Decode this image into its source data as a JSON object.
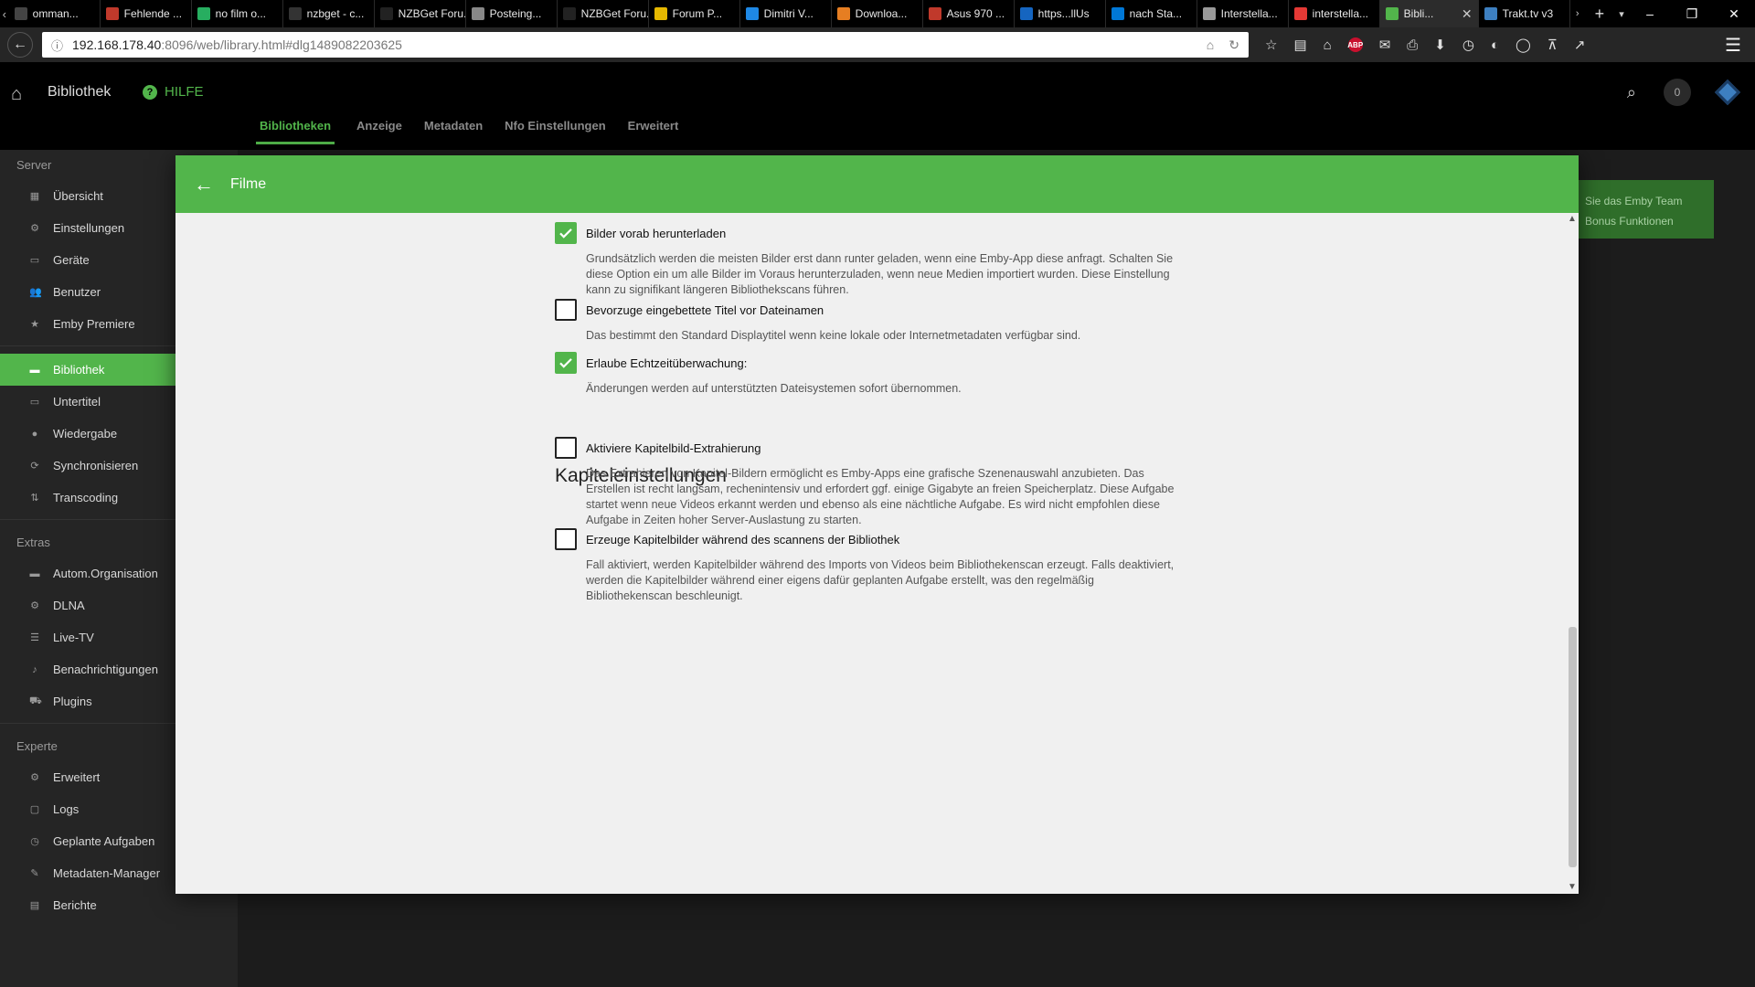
{
  "browser": {
    "tabs": [
      {
        "label": "omman...",
        "color": "#444"
      },
      {
        "label": "Fehlende ...",
        "color": "#c0392b"
      },
      {
        "label": "no film o...",
        "color": "#27ae60"
      },
      {
        "label": "nzbget - c...",
        "color": "#333"
      },
      {
        "label": "NZBGet Foru...",
        "color": "#222"
      },
      {
        "label": "Posteing...",
        "color": "#888"
      },
      {
        "label": "NZBGet Foru...",
        "color": "#222"
      },
      {
        "label": "Forum P...",
        "color": "#e6b800"
      },
      {
        "label": "Dimitri V...",
        "color": "#1e88e5"
      },
      {
        "label": "Downloa...",
        "color": "#e67e22"
      },
      {
        "label": "Asus 970 ...",
        "color": "#c0392b"
      },
      {
        "label": "https...llUs",
        "color": "#1565c0"
      },
      {
        "label": "nach Sta...",
        "color": "#0078d7"
      },
      {
        "label": "Interstella...",
        "color": "#999"
      },
      {
        "label": "interstella...",
        "color": "#e53935"
      },
      {
        "label": "Bibli...",
        "color": "#52b54b",
        "active": true
      },
      {
        "label": "Trakt.tv v3",
        "color": "#3d7fc0"
      }
    ],
    "url_host": "192.168.178.40",
    "url_rest": ":8096/web/library.html#dlg1489082203625"
  },
  "header": {
    "title": "Bibliothek",
    "help_label": "HILFE",
    "notification_count": "0",
    "tabs": [
      "Bibliotheken",
      "Anzeige",
      "Metadaten",
      "Nfo Einstellungen",
      "Erweitert"
    ]
  },
  "sidebar": {
    "sections": [
      {
        "heading": "Server",
        "items": [
          {
            "label": "Übersicht",
            "icon": "dashboard-icon"
          },
          {
            "label": "Einstellungen",
            "icon": "gear-icon"
          },
          {
            "label": "Geräte",
            "icon": "device-icon"
          },
          {
            "label": "Benutzer",
            "icon": "users-icon"
          },
          {
            "label": "Emby Premiere",
            "icon": "star-icon"
          }
        ]
      },
      {
        "heading": "",
        "items": [
          {
            "label": "Bibliothek",
            "icon": "folder-icon",
            "active": true
          },
          {
            "label": "Untertitel",
            "icon": "subtitles-icon"
          },
          {
            "label": "Wiedergabe",
            "icon": "play-icon"
          },
          {
            "label": "Synchronisieren",
            "icon": "sync-icon"
          },
          {
            "label": "Transcoding",
            "icon": "transcode-icon"
          }
        ]
      },
      {
        "heading": "Extras",
        "items": [
          {
            "label": "Autom.Organisation",
            "icon": "folder-icon"
          },
          {
            "label": "DLNA",
            "icon": "gear-icon"
          },
          {
            "label": "Live-TV",
            "icon": "tv-icon"
          },
          {
            "label": "Benachrichtigungen",
            "icon": "bell-icon"
          },
          {
            "label": "Plugins",
            "icon": "cart-icon"
          }
        ]
      },
      {
        "heading": "Experte",
        "items": [
          {
            "label": "Erweitert",
            "icon": "gear-icon"
          },
          {
            "label": "Logs",
            "icon": "folder-open-icon"
          },
          {
            "label": "Geplante Aufgaben",
            "icon": "clock-icon"
          },
          {
            "label": "Metadaten-Manager",
            "icon": "pencil-icon"
          },
          {
            "label": "Berichte",
            "icon": "report-icon"
          }
        ]
      }
    ]
  },
  "promo": {
    "line1": "Sie das Emby Team",
    "line2": "Bonus Funktionen"
  },
  "dialog": {
    "title": "Filme",
    "section_title": "Kapiteleinstellungen",
    "options": [
      {
        "label": "Bilder vorab herunterladen",
        "checked": true,
        "description": "Grundsätzlich werden die meisten Bilder erst dann runter geladen, wenn eine Emby-App diese anfragt. Schalten Sie diese Option ein um alle Bilder im Voraus herunterzuladen, wenn neue Medien importiert wurden. Diese Einstellung kann zu signifikant längeren Bibliothekscans führen."
      },
      {
        "label": "Bevorzuge eingebettete Titel vor Dateinamen",
        "checked": false,
        "description": "Das bestimmt den Standard Displaytitel wenn keine lokale oder Internetmetadaten verfügbar sind."
      },
      {
        "label": "Erlaube Echtzeitüberwachung:",
        "checked": true,
        "description": "Änderungen werden auf unterstützten Dateisystemen sofort übernommen."
      },
      {
        "label": "Aktiviere Kapitelbild-Extrahierung",
        "checked": false,
        "description": "Das Extrahieren von Kapitel-Bildern ermöglicht es Emby-Apps eine grafische Szenenauswahl anzubieten. Das Erstellen ist recht langsam, rechenintensiv und erfordert ggf. einige Gigabyte an freien Speicherplatz. Diese Aufgabe startet wenn neue Videos erkannt werden und ebenso als eine nächtliche Aufgabe. Es wird nicht empfohlen diese Aufgabe in Zeiten hoher Server-Auslastung zu starten."
      },
      {
        "label": "Erzeuge Kapitelbilder während des scannens der Bibliothek",
        "checked": false,
        "description": "Fall aktiviert, werden Kapitelbilder während des Imports von Videos beim Bibliothekenscan erzeugt. Falls deaktiviert, werden die Kapitelbilder während einer eigens dafür geplanten Aufgabe erstellt, was den regelmäßig Bibliothekenscan beschleunigt."
      }
    ]
  },
  "colors": {
    "accent": "#52b54b"
  }
}
